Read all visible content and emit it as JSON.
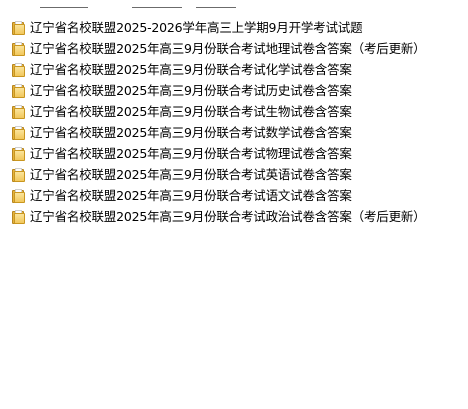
{
  "icons": {
    "folder": "folder-icon"
  },
  "colors": {
    "folder_fill": "#f2c75c",
    "folder_edge": "#b8861f",
    "background": "#ffffff",
    "text": "#000000"
  },
  "files": [
    {
      "name": "辽宁省名校联盟2025-2026学年高三上学期9月开学考试试题"
    },
    {
      "name": "辽宁省名校联盟2025年高三9月份联合考试地理试卷含答案（考后更新）"
    },
    {
      "name": "辽宁省名校联盟2025年高三9月份联合考试化学试卷含答案"
    },
    {
      "name": "辽宁省名校联盟2025年高三9月份联合考试历史试卷含答案"
    },
    {
      "name": "辽宁省名校联盟2025年高三9月份联合考试生物试卷含答案"
    },
    {
      "name": "辽宁省名校联盟2025年高三9月份联合考试数学试卷含答案"
    },
    {
      "name": "辽宁省名校联盟2025年高三9月份联合考试物理试卷含答案"
    },
    {
      "name": "辽宁省名校联盟2025年高三9月份联合考试英语试卷含答案"
    },
    {
      "name": "辽宁省名校联盟2025年高三9月份联合考试语文试卷含答案"
    },
    {
      "name": "辽宁省名校联盟2025年高三9月份联合考试政治试卷含答案（考后更新）"
    }
  ]
}
